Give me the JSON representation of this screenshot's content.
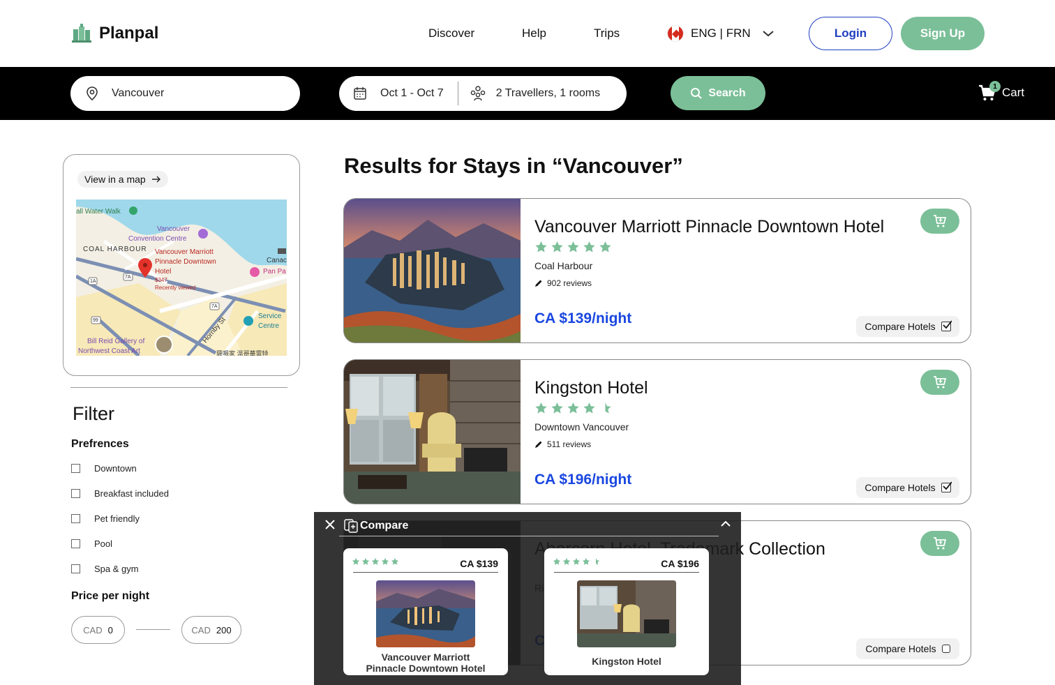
{
  "brand": {
    "name": "Planpal"
  },
  "nav": {
    "discover": "Discover",
    "help": "Help",
    "trips": "Trips"
  },
  "language": {
    "label": "ENG | FRN",
    "flag": "canada-flag-icon"
  },
  "auth": {
    "login": "Login",
    "signup": "Sign Up"
  },
  "search": {
    "location": "Vancouver",
    "dates": "Oct 1 - Oct 7",
    "guests": "2 Travellers, 1 rooms",
    "button": "Search"
  },
  "cart": {
    "label": "Cart",
    "count": "1"
  },
  "sidebar": {
    "map_link": "View in a map",
    "map_labels": {
      "water_walk": "all Water Walk",
      "convention": "Vancouver",
      "convention2": "Convention Centre",
      "coal_harbour": "COAL HARBOUR",
      "hotel_pin1": "Vancouver Marriott",
      "hotel_pin2": "Pinnacle Downtown",
      "hotel_pin3": "Hotel",
      "pin_price": "$347",
      "recently": "Recently viewed",
      "canada": "Canac",
      "pan_pa": "Pan Pa",
      "service1": "Service",
      "service2": "Centre",
      "hornby": "Hornby St",
      "bill1": "Bill Reid Gallery of",
      "bill2": "Northwest Coast Art",
      "chinese": "薩嘅家 温哥華電特",
      "r1a": "1A",
      "r7a": "7A",
      "r7a2": "7A",
      "r99": "99"
    },
    "filter_title": "Filter",
    "preferences_title": "Prefrences",
    "preferences": [
      "Downtown",
      "Breakfast included",
      "Pet friendly",
      "Pool",
      "Spa & gym"
    ],
    "price_title": "Price per night",
    "price_min": {
      "currency": "CAD",
      "value": "0"
    },
    "price_max": {
      "currency": "CAD",
      "value": "200"
    }
  },
  "results": {
    "title": "Results for Stays in “Vancouver”",
    "hotels": [
      {
        "name": "Vancouver Marriott Pinnacle Downtown Hotel",
        "rating": 5,
        "area": "Coal Harbour",
        "reviews": "902 reviews",
        "price": "CA $139/night",
        "compare_label": "Compare Hotels",
        "compared": true
      },
      {
        "name": "Kingston Hotel",
        "rating": 4.5,
        "area": "Downtown Vancouver",
        "reviews": "511 reviews",
        "price": "CA $196/night",
        "compare_label": "Compare Hotels",
        "compared": true
      },
      {
        "name": "Abercorn Hotel, Trademark Collection",
        "rating": 4,
        "area": "Ri",
        "reviews": "",
        "price": "C",
        "compare_label": "Compare Hotels",
        "compared": false
      }
    ]
  },
  "compare_panel": {
    "title": "Compare",
    "items": [
      {
        "name_line1": "Vancouver Marriott",
        "name_line2": "Pinnacle Downtown Hotel",
        "price": "CA $139",
        "rating": 5
      },
      {
        "name_line1": "Kingston Hotel",
        "name_line2": "",
        "price": "CA $196",
        "rating": 4.5
      }
    ]
  },
  "colors": {
    "accent_green": "#7bbf98",
    "price_blue": "#1a47e0",
    "login_blue": "#1e3fbf"
  }
}
